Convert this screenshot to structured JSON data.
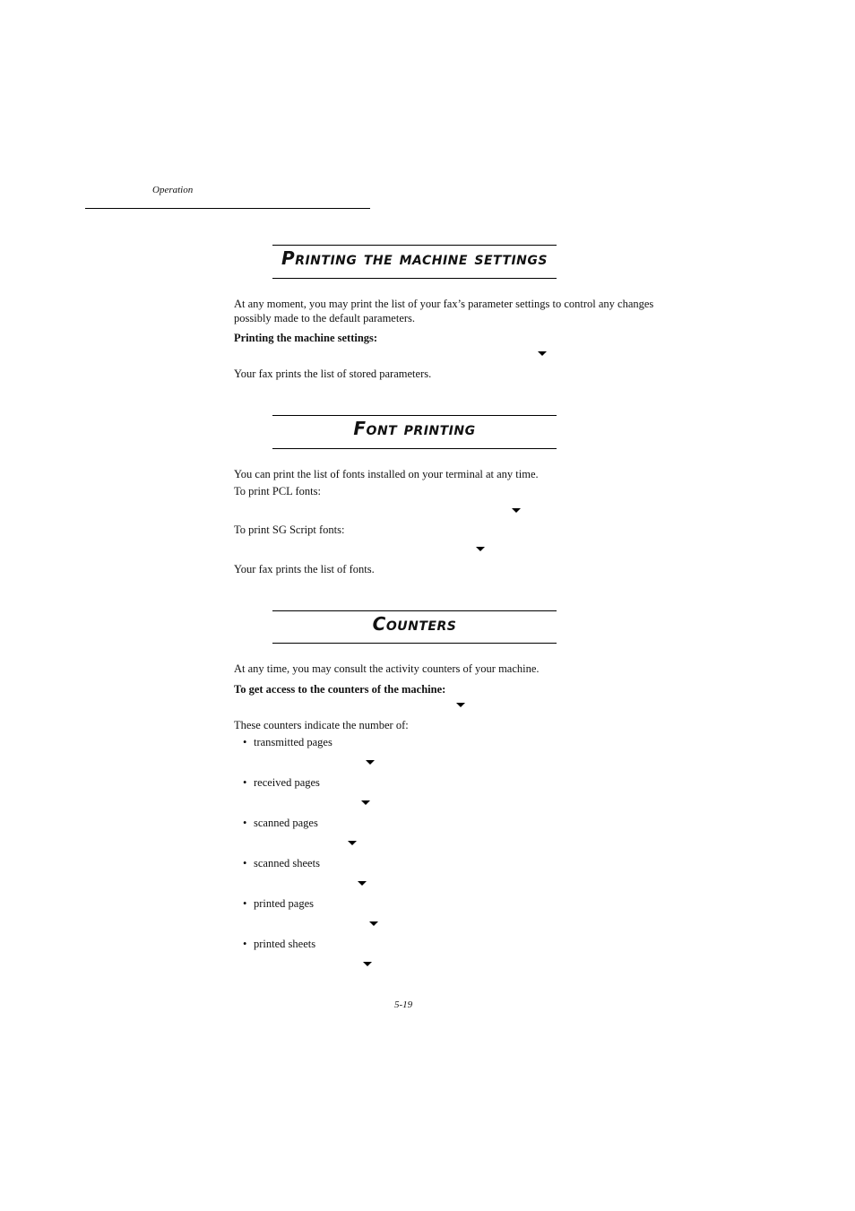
{
  "header": {
    "running_head": "Operation"
  },
  "sections": [
    {
      "title": "Printing the machine settings",
      "paragraphs": [
        "At any moment, you may print the list of your fax’s parameter settings to control any changes",
        "possibly made to the default parameters."
      ],
      "procedure_label": "Printing the machine settings:",
      "result": "Your fax prints the list of stored parameters."
    },
    {
      "title": "Font printing",
      "intro": "You can print the list of fonts installed on your terminal at any time.",
      "step_pcl": "To print PCL fonts:",
      "step_sg": "To print SG Script fonts:",
      "result": "Your fax prints the list of fonts."
    },
    {
      "title": "Counters",
      "intro": "At any time, you may consult the activity counters of your machine.",
      "procedure_label": "To get access to the counters of the machine:",
      "list_intro": "These counters indicate the number of:",
      "items": [
        "transmitted pages",
        "received pages",
        "scanned pages",
        "scanned sheets",
        "printed pages",
        "printed sheets"
      ],
      "bullet_glyph": "•"
    }
  ],
  "footer": {
    "page_number": "5-19"
  },
  "icons": {
    "arrow": "arrow-down-icon"
  }
}
